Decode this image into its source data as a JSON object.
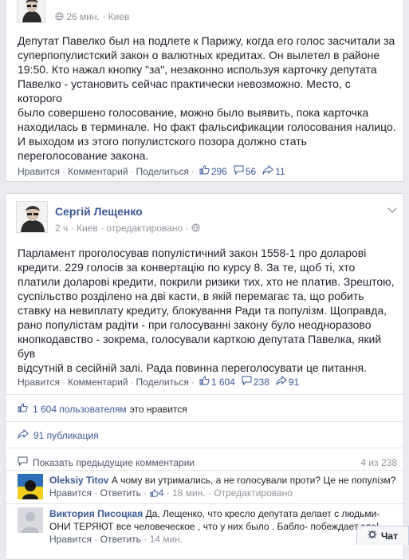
{
  "post1": {
    "time": "26 мин.",
    "sep": "·",
    "location": "Киев",
    "text": [
      "Депутат Павелко был на подлете к Парижу, когда его голос засчитали за",
      "суперпопулистский закон о валютных кредитах. Он вылетел в районе",
      "19:50. Кто нажал кнопку \"за\", незаконно используя карточку депутата",
      "Павелко - установить сейчас практически невозможно. Место, с которого",
      "было совершено голосование, можно было выявить, пока карточка",
      "находилась в терминале. Но факт фальсификации голосования налицо.",
      "И выходом из этого популистского позора должно стать",
      "переголосование закона."
    ],
    "actions": {
      "like": "Нравится",
      "comment": "Комментарий",
      "share": "Поделиться"
    },
    "counts": {
      "likes": "296",
      "comments": "56",
      "shares": "11"
    }
  },
  "post2": {
    "author": "Сергій Лещенко",
    "time": "2 ч",
    "sep": "·",
    "location": "Киев",
    "edited": "отредактировано",
    "text": [
      "Парламент проголосував популістичний закон 1558-1 про доларові",
      "кредити. 229 голосів за конвертацію по курсу 8. За те, щоб ті, хто",
      "платили доларові кредити, покрили ризики тих, хто не платив. Зрештою,",
      "суспільство розділено на дві касти, в якій перемагає та, що робить",
      "ставку на невиплату кредиту, блокування Ради та популізм. Щоправда,",
      "рано популістам радіти - при голосуванні закону було неодноразово",
      "кнопкодавство - зокрема, голосували карткою депутата Павелка, який був",
      "відсутній в сесійній залі. Рада повинна переголосувати це питання."
    ],
    "actions": {
      "like": "Нравится",
      "comment": "Комментарий",
      "share": "Поделиться"
    },
    "counts": {
      "likes": "1 604",
      "comments": "238",
      "shares": "91"
    },
    "likes_summary": {
      "count": "1 604 пользователям",
      "rest": "это нравится"
    },
    "shares_summary": "91 публикация",
    "prev_comments": "Показать предыдущие комментарии",
    "pager": "4 из 238",
    "comments": [
      {
        "author": "Oleksiy Titov",
        "text": "А чому ви утримались, а не голосували проти? Це не популізм?",
        "like": "Нравится",
        "reply": "Ответить",
        "likes": "4",
        "time": "18 мин.",
        "edited": "Отредактировано"
      },
      {
        "author": "Виктория Писоцкая",
        "text1": "Да, Лещенко, что кресло депутата делает с людьми-",
        "text2": "ОНИ ТЕРЯЮТ все человеческое , что у них было . Бабло- побеждает зло!",
        "like": "Нравится",
        "reply": "Ответить",
        "time": "14 мин."
      }
    ]
  },
  "chat": {
    "label": "Чат"
  },
  "colors": {
    "link": "#3b5998",
    "muted": "#90949c",
    "border": "#d3d6db"
  }
}
